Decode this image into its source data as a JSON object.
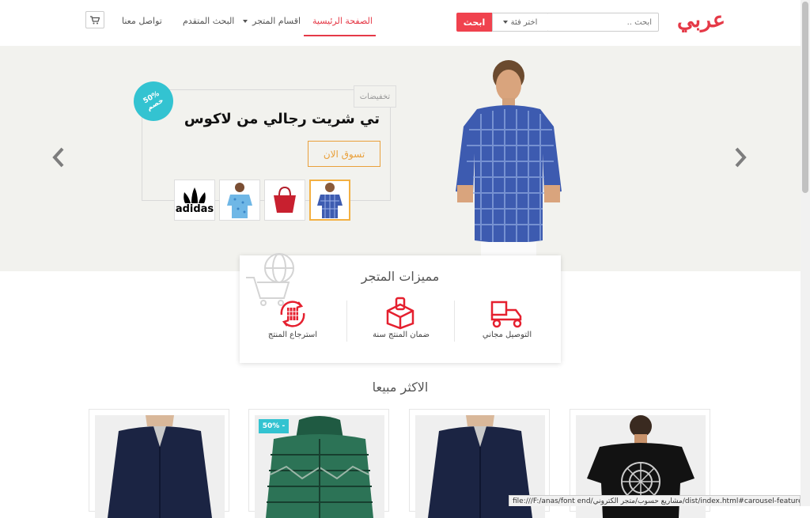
{
  "header": {
    "logo": "عربي",
    "search": {
      "placeholder": "ابحث ..",
      "category": "اختر فئة",
      "button": "ابحث"
    },
    "nav": [
      "الصفحة الرئيسية",
      "اقسام المتجر",
      "البحث المتقدم",
      "تواصل معنا"
    ],
    "cart_icon": "cart-icon"
  },
  "hero": {
    "badge": {
      "line1": "50%",
      "line2": "خصم"
    },
    "tag": "تخفيضات",
    "title": "تي شريت رجالي من لاكوس",
    "button": "تسوق الان",
    "thumbnails": [
      "plaid-shirt",
      "red-bag",
      "blue-shirt",
      "adidas-logo"
    ],
    "brand_text": "adidas"
  },
  "features": {
    "title": "مميزات المتجر",
    "items": [
      {
        "icon": "delivery-scooter-icon",
        "label": "التوصيل مجاني"
      },
      {
        "icon": "warranty-box-icon",
        "label": "ضمان المنتج سنة"
      },
      {
        "icon": "product-return-icon",
        "label": "استرجاع المنتج"
      }
    ]
  },
  "bestsellers": {
    "title": "الاكثر مبيعا",
    "sale_badge": "50% -"
  },
  "status_bar": "file:///F:/anas/font end/مشاريع حسوب/متجر الكتروني/dist/index.html#carousel-featured",
  "colors": {
    "accent": "#e53947",
    "teal": "#33c3d1",
    "orange": "#e9a03b"
  }
}
